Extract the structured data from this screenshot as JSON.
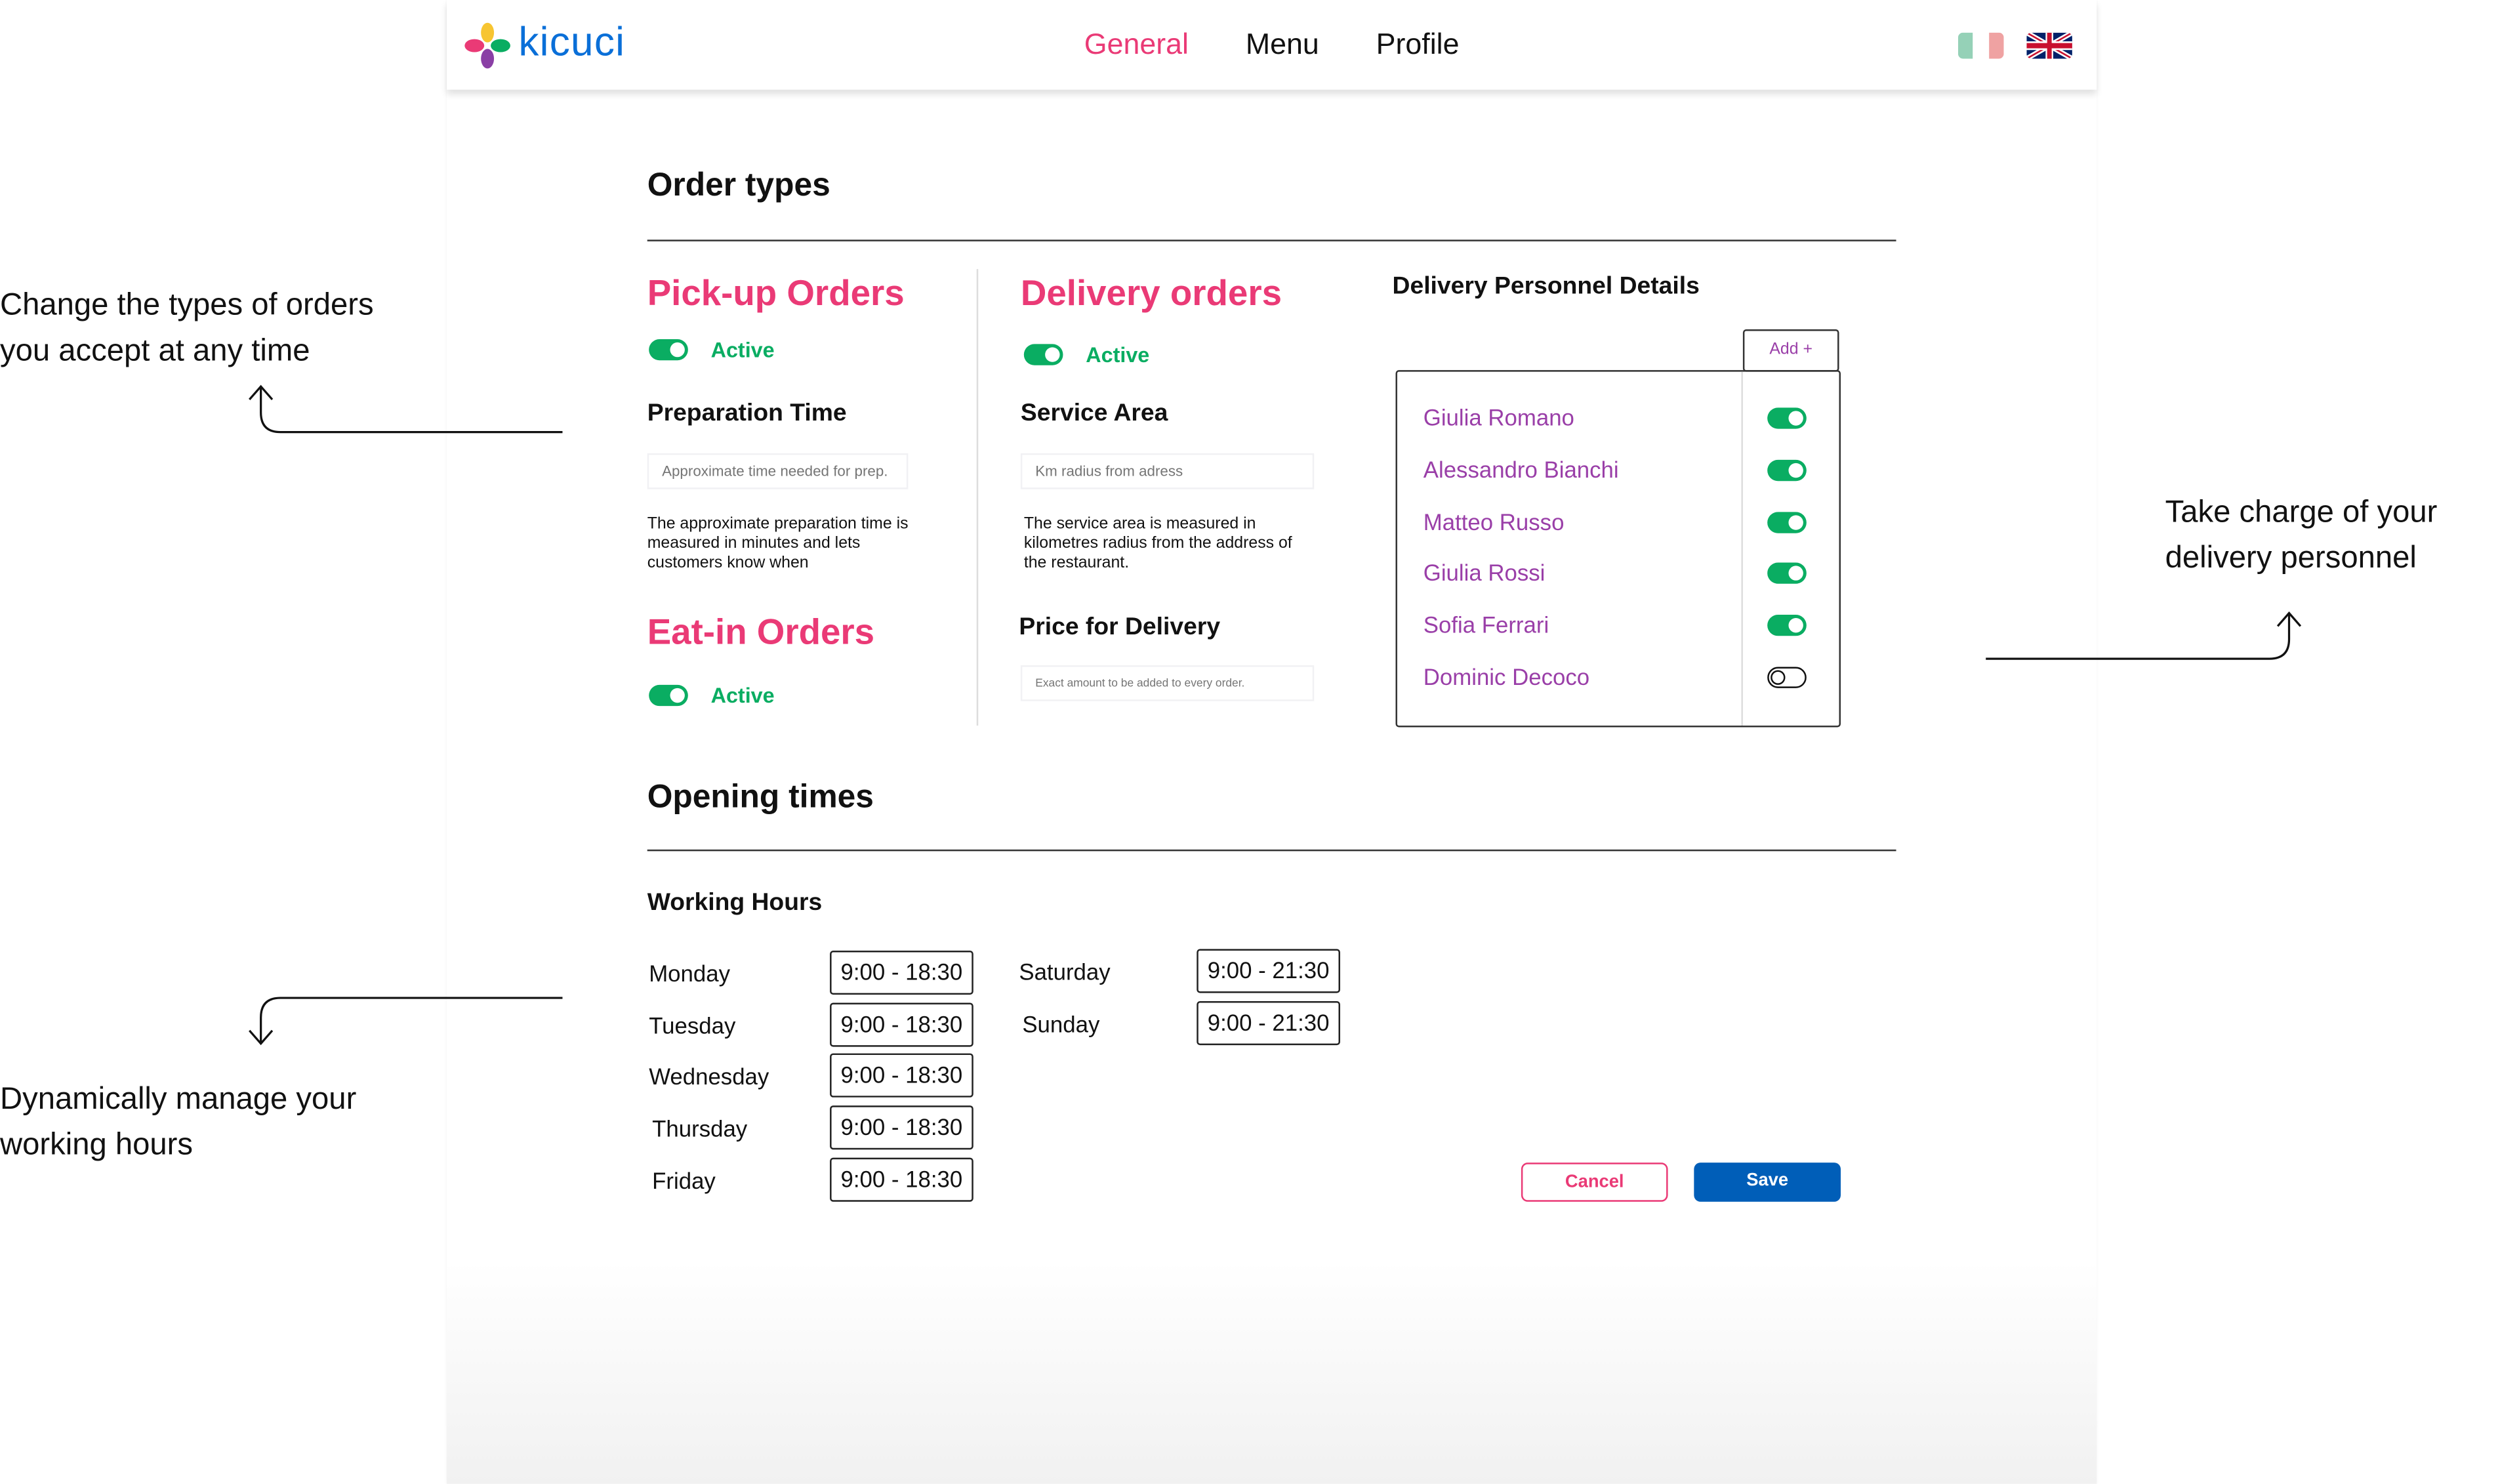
{
  "header": {
    "logo": "kicuci",
    "nav": [
      {
        "label": "General",
        "active": true
      },
      {
        "label": "Menu"
      },
      {
        "label": "Profile"
      }
    ],
    "languages": [
      "Italian",
      "English"
    ]
  },
  "colors": {
    "accent": "#ea3a76",
    "active": "#0aad62",
    "primary": "#005eb8",
    "name": "#9a3fa8"
  },
  "order_types": {
    "title": "Order types",
    "pickup": {
      "title": "Pick-up Orders",
      "status": "Active",
      "enabled": true,
      "field_label": "Preparation Time",
      "placeholder": "Approximate time needed for prep.",
      "description": "The approximate preparation time is measured in minutes and lets customers know when"
    },
    "eatin": {
      "title": "Eat-in Orders",
      "status": "Active",
      "enabled": true
    },
    "delivery": {
      "title": "Delivery orders",
      "status": "Active",
      "enabled": true,
      "area_label": "Service Area",
      "area_placeholder": "Km radius from adress",
      "area_description": "The service area is measured in kilometres radius from the address of the restaurant.",
      "price_label": "Price for Delivery",
      "price_placeholder": "Exact amount to be added to every order."
    },
    "personnel": {
      "title": "Delivery Personnel Details",
      "add_label": "Add +",
      "people": [
        {
          "name": "Giulia Romano",
          "enabled": true
        },
        {
          "name": "Alessandro Bianchi",
          "enabled": true
        },
        {
          "name": "Matteo Russo",
          "enabled": true
        },
        {
          "name": "Giulia Rossi",
          "enabled": true
        },
        {
          "name": "Sofia Ferrari",
          "enabled": true
        },
        {
          "name": "Dominic Decoco",
          "enabled": false
        }
      ]
    }
  },
  "opening": {
    "title": "Opening times",
    "subtitle": "Working Hours",
    "days": [
      {
        "day": "Monday",
        "hours": "9:00 - 18:30"
      },
      {
        "day": "Tuesday",
        "hours": "9:00 - 18:30"
      },
      {
        "day": "Wednesday",
        "hours": "9:00 - 18:30"
      },
      {
        "day": "Thursday",
        "hours": "9:00 - 18:30"
      },
      {
        "day": "Friday",
        "hours": "9:00 - 18:30"
      },
      {
        "day": "Saturday",
        "hours": "9:00 - 21:30"
      },
      {
        "day": "Sunday",
        "hours": "9:00 - 21:30"
      }
    ]
  },
  "actions": {
    "cancel": "Cancel",
    "save": "Save"
  },
  "annotations": {
    "order_types": [
      "Change the types of orders",
      "you accept at any time"
    ],
    "hours": [
      "Dynamically manage your",
      "working hours"
    ],
    "personnel": [
      "Take charge of your",
      "delivery personnel"
    ]
  }
}
